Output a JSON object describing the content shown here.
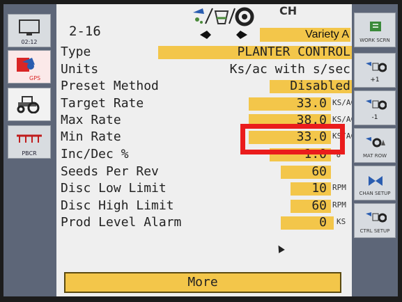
{
  "header": {
    "page_number": "2-16",
    "channel": "CH",
    "variety": "Variety A"
  },
  "left_sidebar": {
    "clock": "02:12",
    "gps_label": "GPS",
    "pbcr_label": "PBCR"
  },
  "rows": [
    {
      "label": "Type",
      "value": "PLANTER CONTROL",
      "unit": ""
    },
    {
      "label": "Units",
      "value": "Ks/ac with s/sec",
      "unit": ""
    },
    {
      "label": "Preset Method",
      "value": "Disabled",
      "unit": ""
    },
    {
      "label": "Target Rate",
      "value": "33.0",
      "unit": "KS/AC"
    },
    {
      "label": "Max Rate",
      "value": "38.0",
      "unit": "KS/AC"
    },
    {
      "label": "Min Rate",
      "value": "33.0",
      "unit": "KS/AC"
    },
    {
      "label": "Inc/Dec %",
      "value": "1.0",
      "unit": "%"
    },
    {
      "label": "Seeds Per Rev",
      "value": "60",
      "unit": ""
    },
    {
      "label": "Disc Low Limit",
      "value": "10",
      "unit": "RPM"
    },
    {
      "label": "Disc High Limit",
      "value": "60",
      "unit": "RPM"
    },
    {
      "label": "Prod Level Alarm",
      "value": "0",
      "unit": "KS"
    }
  ],
  "more_label": "More",
  "right_sidebar": {
    "work_screen": "WORK SCRN",
    "plus_one": "+1",
    "minus_one": "-1",
    "mat_row": "MAT ROW",
    "chan_setup": "CHAN SETUP",
    "ctrl_setup": "CTRL SETUP"
  },
  "colors": {
    "field_yellow": "#f3c64a",
    "highlight_red": "#ea1c1c",
    "panel_blue_gray": "#5d6678"
  }
}
